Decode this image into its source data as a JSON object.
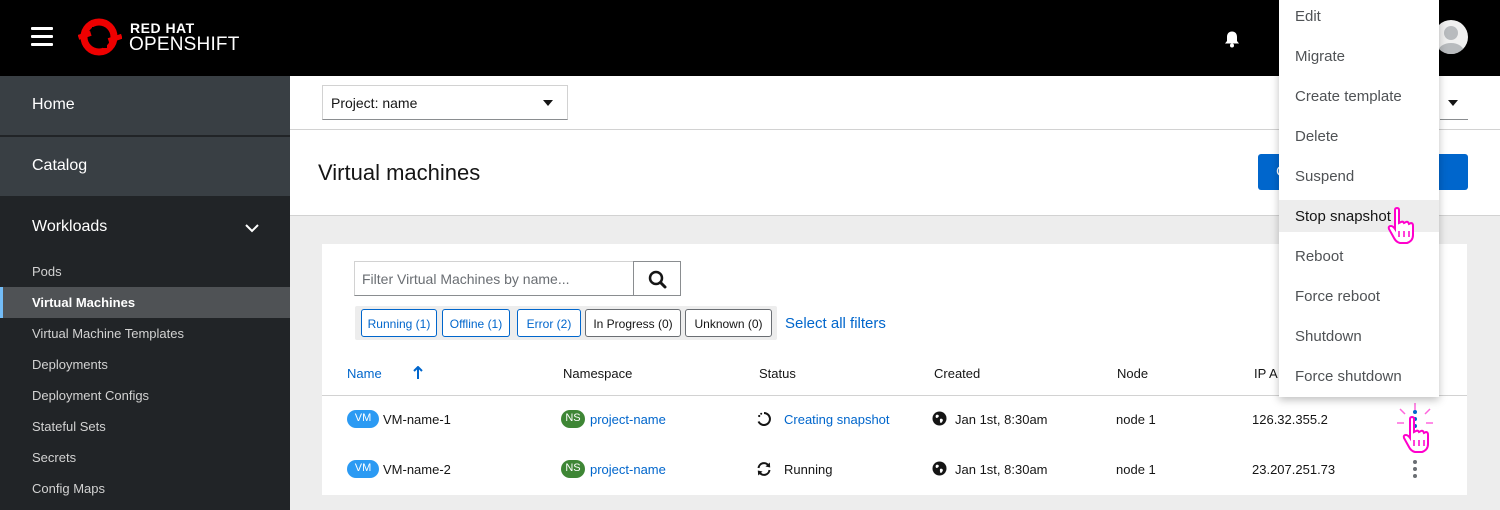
{
  "masthead": {
    "brand_top": "RED HAT",
    "brand_bottom": "OPENSHIFT",
    "icons": {
      "menu": "hamburger-icon",
      "notifications": "bell-icon",
      "user": "avatar-icon"
    },
    "colors": {
      "background": "#000000",
      "logo": "#ee0000"
    }
  },
  "sidebar": {
    "sections": [
      {
        "label": "Home"
      },
      {
        "label": "Catalog"
      },
      {
        "label": "Workloads",
        "expanded": true
      }
    ],
    "subitems": [
      {
        "label": "Pods",
        "active": false
      },
      {
        "label": "Virtual Machines",
        "active": true
      },
      {
        "label": "Virtual Machine Templates",
        "active": false
      },
      {
        "label": "Deployments",
        "active": false
      },
      {
        "label": "Deployment Configs",
        "active": false
      },
      {
        "label": "Stateful Sets",
        "active": false
      },
      {
        "label": "Secrets",
        "active": false
      },
      {
        "label": "Config Maps",
        "active": false
      }
    ],
    "colors": {
      "background": "#212427",
      "section": "#393f44",
      "active": "#4f5255",
      "active_accent": "#73bcf7"
    }
  },
  "project_bar": {
    "project_select": "Project: name"
  },
  "page": {
    "title": "Virtual machines",
    "primary_button_label": "C",
    "accent": "#0066cc"
  },
  "filter": {
    "placeholder": "Filter Virtual Machines by name...",
    "chips": [
      {
        "label": "Running (1)",
        "selected": true
      },
      {
        "label": "Offline (1)",
        "selected": true
      },
      {
        "label": "Error (2)",
        "selected": true
      },
      {
        "label": "In Progress (0)",
        "selected": false
      },
      {
        "label": "Unknown (0)",
        "selected": false
      }
    ],
    "select_all": "Select all filters"
  },
  "table": {
    "columns": [
      "Name",
      "Namespace",
      "Status",
      "Created",
      "Node",
      "IP A"
    ],
    "sorted_column": "Name",
    "rows": [
      {
        "badge": "VM",
        "name": "VM-name-1",
        "ns_badge": "NS",
        "namespace": "project-name",
        "status": "Creating snapshot",
        "status_icon": "spinner-icon",
        "created": "Jan 1st, 8:30am",
        "node": "node 1",
        "ip": "126.32.355.2"
      },
      {
        "badge": "VM",
        "name": "VM-name-2",
        "ns_badge": "NS",
        "namespace": "project-name",
        "status": "Running",
        "status_icon": "sync-icon",
        "created": "Jan 1st, 8:30am",
        "node": "node 1",
        "ip": "23.207.251.73"
      }
    ]
  },
  "kebab_menu": {
    "items": [
      "Edit",
      "Migrate",
      "Create template",
      "Delete",
      "Suspend",
      "Stop snapshot",
      "Reboot",
      "Force reboot",
      "Shutdown",
      "Force shutdown"
    ],
    "hovered": "Stop snapshot",
    "cursor_color": "#ff00cc"
  }
}
